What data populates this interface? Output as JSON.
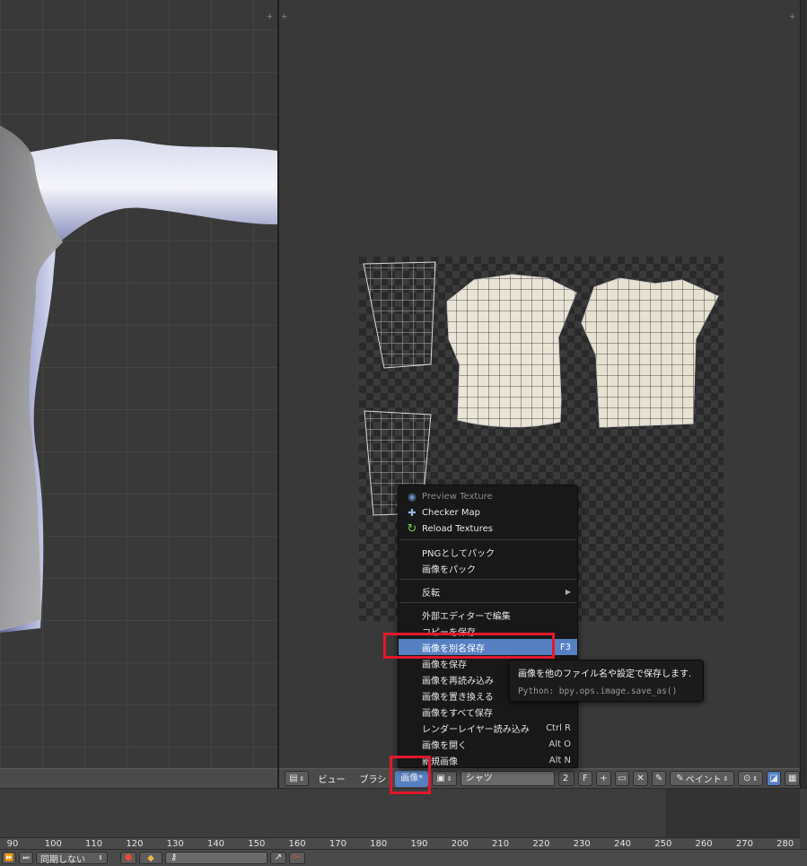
{
  "image_menu": {
    "items": [
      {
        "label": "Preview Texture",
        "icon": "preview-texture-icon",
        "disabled": true
      },
      {
        "label": "Checker Map",
        "icon": "checker-map-icon"
      },
      {
        "label": "Reload Textures",
        "icon": "reload-icon"
      },
      {
        "label": "PNGとしてパック"
      },
      {
        "label": "画像をパック"
      },
      {
        "label": "反転",
        "submenu": true
      },
      {
        "label": "外部エディターで編集"
      },
      {
        "label": "コピーを保存"
      },
      {
        "label": "画像を別名保存",
        "shortcut": "F3",
        "highlighted": true
      },
      {
        "label": "画像を保存"
      },
      {
        "label": "画像を再読み込み"
      },
      {
        "label": "画像を置き換える"
      },
      {
        "label": "画像をすべて保存"
      },
      {
        "label": "レンダーレイヤー読み込み",
        "shortcut": "Ctrl R"
      },
      {
        "label": "画像を開く",
        "shortcut": "Alt O"
      },
      {
        "label": "新規画像",
        "shortcut": "Alt N"
      }
    ]
  },
  "tooltip": {
    "description": "画像を他のファイル名や設定で保存します.",
    "python": "Python: bpy.ops.image.save_as()"
  },
  "editor_header": {
    "view_menu": "ビュー",
    "brush_menu": "ブラシ",
    "image_menu": "画像*",
    "image_name": "シャツ",
    "users_count": "2",
    "fake_user": "F",
    "mode": "ペイント"
  },
  "timeline": {
    "ticks": [
      "90",
      "100",
      "110",
      "120",
      "130",
      "140",
      "150",
      "160",
      "170",
      "180",
      "190",
      "200",
      "210",
      "220",
      "230",
      "240",
      "250",
      "260",
      "270",
      "280"
    ],
    "sync_mode": "同期しない"
  },
  "colors": {
    "highlight": "#5680c2",
    "annotation": "#e3172b",
    "menu_bg": "#181818"
  }
}
